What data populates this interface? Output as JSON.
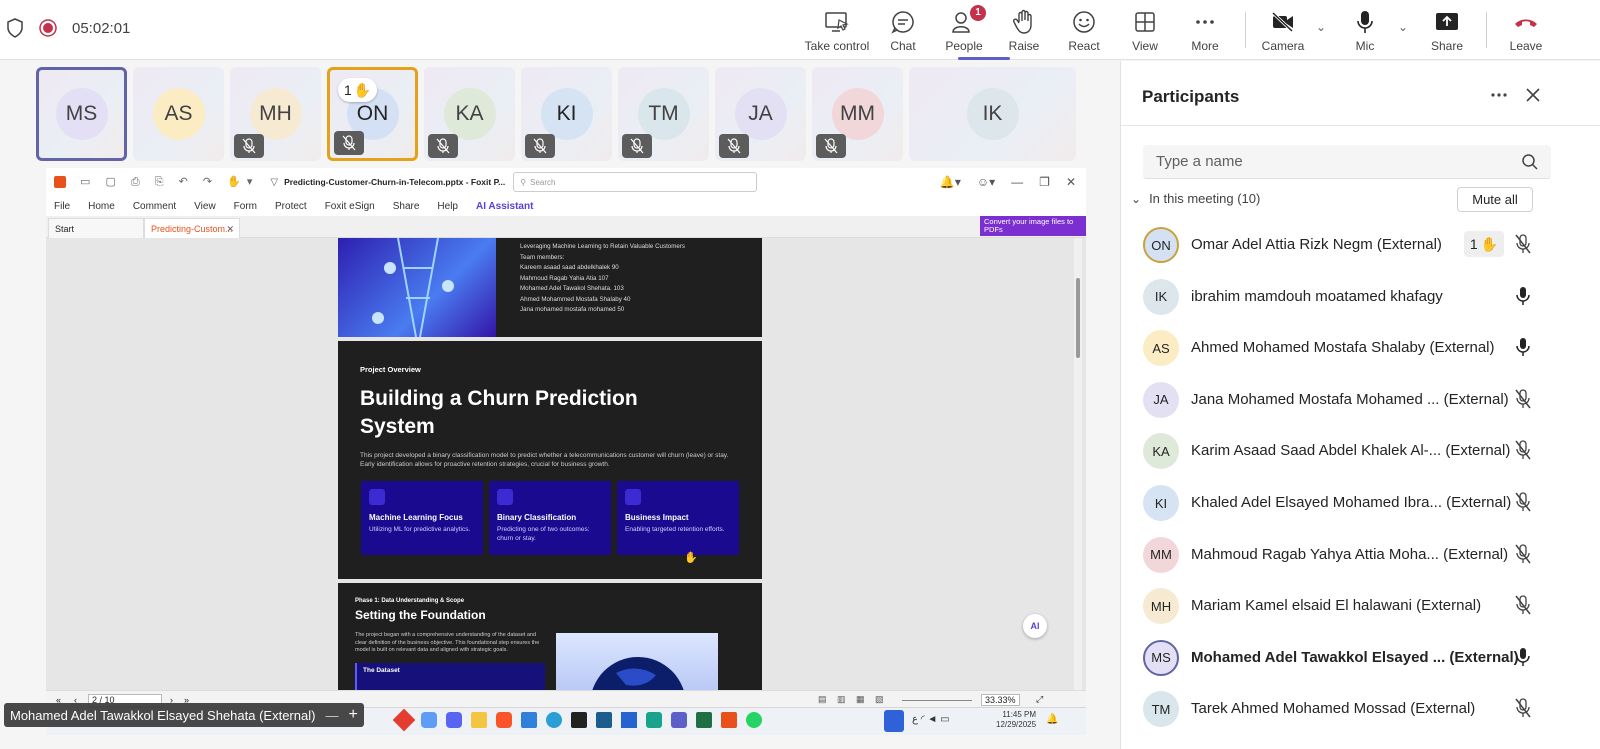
{
  "meeting": {
    "timer": "05:02:01",
    "toolbar": [
      {
        "key": "take-control",
        "label": "Take control"
      },
      {
        "key": "chat",
        "label": "Chat"
      },
      {
        "key": "people",
        "label": "People",
        "badge": "1"
      },
      {
        "key": "raise",
        "label": "Raise"
      },
      {
        "key": "react",
        "label": "React"
      },
      {
        "key": "view",
        "label": "View"
      },
      {
        "key": "more",
        "label": "More"
      },
      {
        "key": "camera",
        "label": "Camera"
      },
      {
        "key": "mic",
        "label": "Mic"
      },
      {
        "key": "share",
        "label": "Share"
      },
      {
        "key": "leave",
        "label": "Leave"
      }
    ]
  },
  "gallery": [
    {
      "initials": "MS",
      "color": "#e3e0f5",
      "text": "#424242"
    },
    {
      "initials": "AS",
      "color": "#fbecc4",
      "text": "#424242"
    },
    {
      "initials": "MH",
      "color": "#f6ead2",
      "text": "#424242"
    },
    {
      "initials": "ON",
      "color": "#d4e1f5",
      "text": "#242424",
      "hand": "1"
    },
    {
      "initials": "KA",
      "color": "#dfe9d9",
      "text": "#424242"
    },
    {
      "initials": "KI",
      "color": "#d5e3f3",
      "text": "#242424"
    },
    {
      "initials": "TM",
      "color": "#d9e6ec",
      "text": "#424242"
    },
    {
      "initials": "JA",
      "color": "#e4e0f3",
      "text": "#424242"
    },
    {
      "initials": "MM",
      "color": "#f2d7da",
      "text": "#424242"
    },
    {
      "initials": "IK",
      "color": "#dde6ea",
      "text": "#424242"
    }
  ],
  "foxit": {
    "file_title": "Predicting-Customer-Churn-in-Telecom.pptx - Foxit P...",
    "search_placeholder": "Search",
    "menu": [
      "File",
      "Home",
      "Comment",
      "View",
      "Form",
      "Protect",
      "Foxit eSign",
      "Share",
      "Help",
      "AI Assistant"
    ],
    "tabs": [
      "Start",
      "Predicting-Custom..."
    ],
    "convert_banner": "Convert your image files to PDFs",
    "page_indicator": "2 / 10",
    "zoom": "33.33%"
  },
  "slides": {
    "s1_lines": [
      "Leveraging Machine Learning to Retain Valuable Customers",
      "Team members:",
      "Kareem asaad saad abdelkhalek 90",
      "Mahmoud Ragab Yahia Atia 107",
      "Mohamed Adel Tawakol Shehata. 103",
      "Ahmed Mohammed Mostafa Shalaby 40",
      "Jana mohamed mostafa mohamed 50"
    ],
    "s2_label": "Project Overview",
    "s2_title": "Building a Churn Prediction System",
    "s2_body": "This project developed a binary classification model to predict whether a telecommunications customer will churn (leave) or stay. Early identification allows for proactive retention strategies, crucial for business growth.",
    "cards": [
      {
        "title": "Machine Learning Focus",
        "desc": "Utilizing ML for predictive analytics."
      },
      {
        "title": "Binary Classification",
        "desc": "Predicting one of two outcomes: churn or stay."
      },
      {
        "title": "Business Impact",
        "desc": "Enabling targeted retention efforts."
      }
    ],
    "s3_label": "Phase 1: Data Understanding & Scope",
    "s3_title": "Setting the Foundation",
    "s3_body": "The project began with a comprehensive understanding of the dataset and clear definition of the business objective. This foundational step ensures the model is built on relevant data and aligned with strategic goals.",
    "s3_box": "The Dataset"
  },
  "taskbar": {
    "time": "11:45 PM",
    "date": "12/29/2025"
  },
  "presenter_tag": "Mohamed Adel Tawakkol Elsayed Shehata (External)",
  "participants": {
    "title": "Participants",
    "search_placeholder": "Type a name",
    "section": "In this meeting (10)",
    "mute_all": "Mute all",
    "list": [
      {
        "initials": "ON",
        "name": "Omar Adel Attia Rizk Negm",
        "ext": "(External)",
        "mic": "off",
        "hand": "1",
        "color": "#d4e1f5",
        "ring": "#c8a23a"
      },
      {
        "initials": "IK",
        "name": "ibrahim mamdouh moatamed khafagy",
        "ext": "",
        "mic": "on",
        "color": "#dde6ea"
      },
      {
        "initials": "AS",
        "name": "Ahmed Mohamed Mostafa Shalaby",
        "ext": "(External)",
        "mic": "on",
        "color": "#fbecc4"
      },
      {
        "initials": "JA",
        "name": "Jana Mohamed Mostafa Mohamed ...",
        "ext": "(External)",
        "mic": "off",
        "color": "#e4e0f3"
      },
      {
        "initials": "KA",
        "name": "Karim Asaad Saad Abdel Khalek Al-...",
        "ext": "(External)",
        "mic": "off",
        "color": "#dfe9d9"
      },
      {
        "initials": "KI",
        "name": "Khaled Adel Elsayed Mohamed Ibra...",
        "ext": "(External)",
        "mic": "off",
        "color": "#d5e3f3"
      },
      {
        "initials": "MM",
        "name": "Mahmoud Ragab Yahya Attia Moha...",
        "ext": "(External)",
        "mic": "off",
        "color": "#f2d7da"
      },
      {
        "initials": "MH",
        "name": "Mariam Kamel elsaid El halawani",
        "ext": "(External)",
        "mic": "off",
        "color": "#f6ead2"
      },
      {
        "initials": "MS",
        "name": "Mohamed Adel Tawakkol Elsayed ...",
        "ext": "(External)",
        "mic": "on",
        "color": "#e3e0f5",
        "bold": true,
        "ring": "#6264a7"
      },
      {
        "initials": "TM",
        "name": "Tarek Ahmed Mohamed Mossad",
        "ext": "(External)",
        "mic": "off",
        "color": "#d9e6ec"
      }
    ]
  }
}
